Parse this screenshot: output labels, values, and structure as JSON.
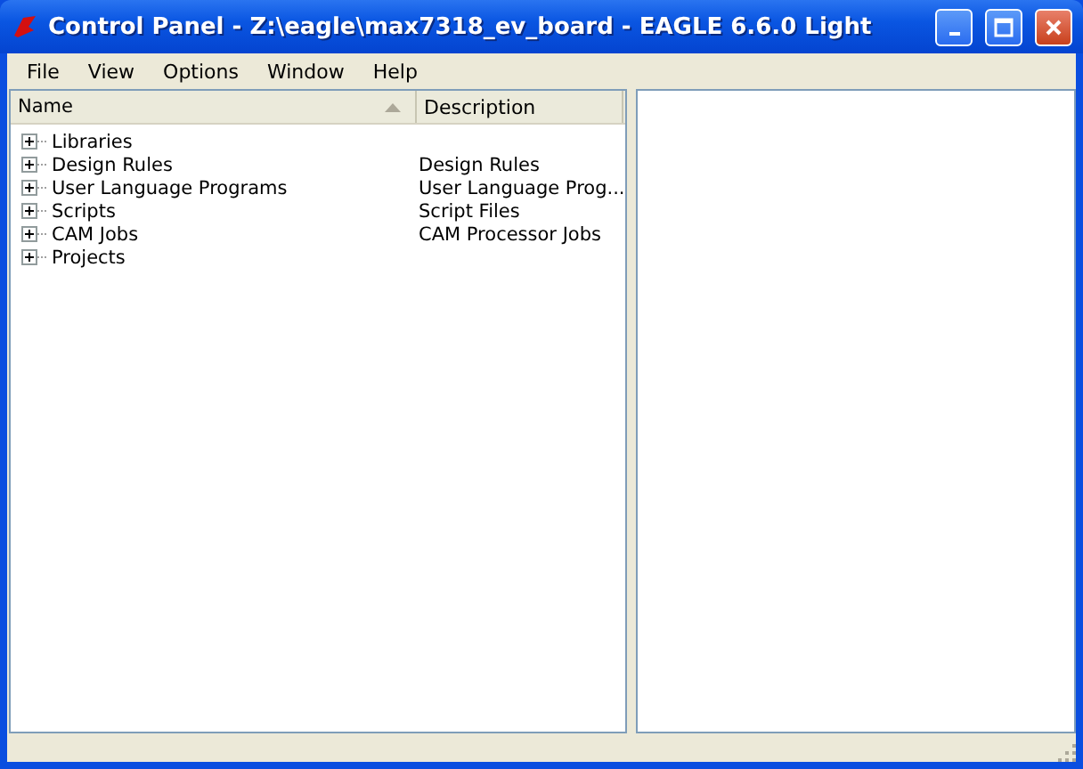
{
  "window": {
    "title": "Control Panel - Z:\\eagle\\max7318_ev_board - EAGLE 6.6.0 Light"
  },
  "menu": [
    "File",
    "View",
    "Options",
    "Window",
    "Help"
  ],
  "tree": {
    "columns": [
      "Name",
      "Description"
    ],
    "items": [
      {
        "name": "Libraries",
        "expanded": false
      },
      {
        "name": "Design Rules",
        "description": "Design Rules",
        "expanded": false
      },
      {
        "name": "User Language Programs",
        "description": "User Language Prog...",
        "expanded": false
      },
      {
        "name": "Scripts",
        "description": "Script Files",
        "expanded": false
      },
      {
        "name": "CAM Jobs",
        "description": "CAM Processor Jobs",
        "expanded": false
      },
      {
        "name": "Projects",
        "expanded": false
      }
    ]
  }
}
